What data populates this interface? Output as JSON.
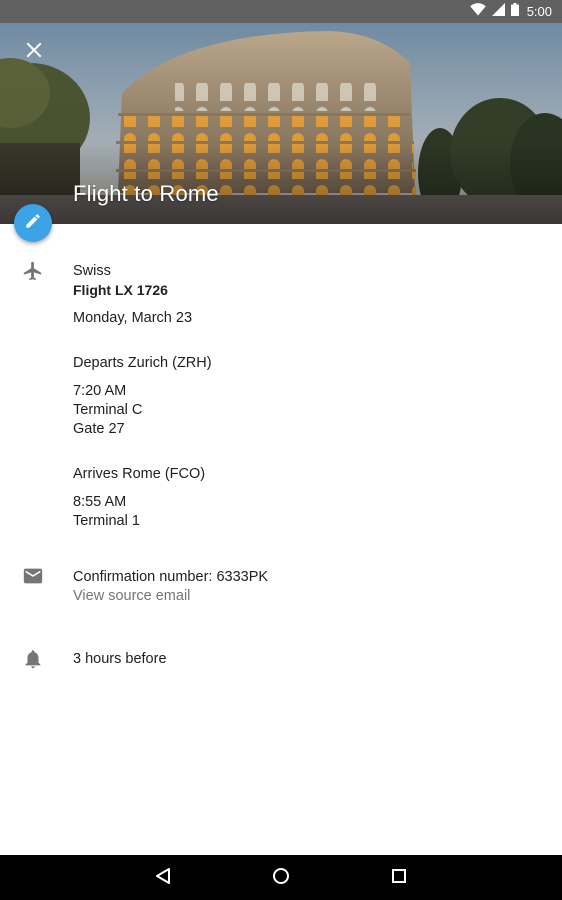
{
  "status_bar": {
    "time": "5:00",
    "icons": [
      "wifi-icon",
      "cellular-signal-icon",
      "battery-icon"
    ]
  },
  "header": {
    "title": "Flight to Rome",
    "close_icon": "close-icon",
    "edit_icon": "edit-pencil-icon"
  },
  "flight": {
    "icon": "airplane-icon",
    "airline": "Swiss",
    "flight_number": "Flight LX 1726",
    "date": "Monday, March 23",
    "departure": {
      "heading": "Departs Zurich (ZRH)",
      "time": "7:20 AM",
      "terminal": "Terminal C",
      "gate": "Gate 27"
    },
    "arrival": {
      "heading": "Arrives Rome (FCO)",
      "time": "8:55 AM",
      "terminal": "Terminal 1"
    }
  },
  "confirmation": {
    "icon": "email-icon",
    "text": "Confirmation number: 6333PK",
    "link": "View source email"
  },
  "reminder": {
    "icon": "bell-icon",
    "text": "3 hours before"
  },
  "nav_bar": {
    "icons": [
      "back-triangle-icon",
      "home-circle-icon",
      "recents-square-icon"
    ]
  },
  "colors": {
    "status_bar": "#616161",
    "fab": "#3ba3e6",
    "nav_bar": "#000000",
    "secondary_text": "#757575",
    "icon_gray": "#757575"
  }
}
